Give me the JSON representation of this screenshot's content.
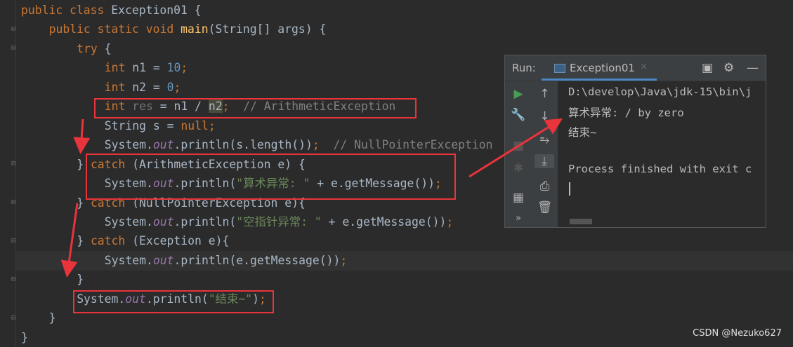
{
  "code_lines": [
    [
      [
        "public class ",
        "kw"
      ],
      [
        "Exception01 {",
        ""
      ]
    ],
    [
      [
        "public static void ",
        "kw"
      ],
      [
        "main",
        "fn"
      ],
      [
        "(String[] args) {",
        ""
      ]
    ],
    [
      [
        "try ",
        "kw"
      ],
      [
        "{",
        ""
      ]
    ],
    [
      [
        "int ",
        "kw"
      ],
      [
        "n1 = ",
        ""
      ],
      [
        "10",
        "num"
      ],
      [
        ";",
        "semi"
      ]
    ],
    [
      [
        "int ",
        "kw"
      ],
      [
        "n2 = ",
        ""
      ],
      [
        "0",
        "num"
      ],
      [
        ";",
        "semi"
      ]
    ],
    [
      [
        "int ",
        "kw"
      ],
      [
        "res",
        "unused"
      ],
      [
        " = n1 / ",
        ""
      ],
      [
        "n2",
        "hl"
      ],
      [
        ";",
        "semi"
      ],
      [
        "  // ArithmeticException",
        "cmt"
      ]
    ],
    [
      [
        "String s = ",
        ""
      ],
      [
        "null",
        "kw"
      ],
      [
        ";",
        "semi"
      ]
    ],
    [
      [
        "System.",
        ""
      ],
      [
        "out",
        "fld"
      ],
      [
        ".println(s.length())",
        ""
      ],
      [
        ";",
        "semi"
      ],
      [
        "  // NullPointerException",
        "cmt"
      ]
    ],
    [
      [
        "} ",
        ""
      ],
      [
        "catch ",
        "kw"
      ],
      [
        "(ArithmeticException e) {",
        ""
      ]
    ],
    [
      [
        "System.",
        ""
      ],
      [
        "out",
        "fld"
      ],
      [
        ".println(",
        ""
      ],
      [
        "\"算术异常: \"",
        "str"
      ],
      [
        " + e.getMessage())",
        ""
      ],
      [
        ";",
        "semi"
      ]
    ],
    [
      [
        "} ",
        ""
      ],
      [
        "catch ",
        "kw"
      ],
      [
        "(NullPointerException e){",
        ""
      ]
    ],
    [
      [
        "System.",
        ""
      ],
      [
        "out",
        "fld"
      ],
      [
        ".println(",
        ""
      ],
      [
        "\"空指针异常: \"",
        "str"
      ],
      [
        " + e.getMessage())",
        ""
      ],
      [
        ";",
        "semi"
      ]
    ],
    [
      [
        "} ",
        ""
      ],
      [
        "catch ",
        "kw"
      ],
      [
        "(Exception e){",
        ""
      ]
    ],
    [
      [
        "System.",
        ""
      ],
      [
        "out",
        "fld"
      ],
      [
        ".println(e.getMessage())",
        ""
      ],
      [
        ";",
        "semi"
      ]
    ],
    [
      [
        "}",
        ""
      ]
    ],
    [
      [
        "System.",
        ""
      ],
      [
        "out",
        "fld"
      ],
      [
        ".println(",
        ""
      ],
      [
        "\"结束~\"",
        "str"
      ],
      [
        ")",
        ""
      ],
      [
        ";",
        "semi"
      ]
    ],
    [
      [
        "}",
        ""
      ]
    ],
    [
      [
        "}",
        ""
      ]
    ]
  ],
  "code_indents": [
    0,
    1,
    2,
    3,
    3,
    3,
    3,
    3,
    2,
    3,
    2,
    3,
    2,
    3,
    2,
    2,
    1,
    0
  ],
  "run_panel": {
    "label": "Run:",
    "tab": "Exception01",
    "tab_close": "×",
    "console_lines": [
      "D:\\develop\\Java\\jdk-15\\bin\\j",
      "算术异常: / by zero",
      "结束~",
      "",
      "Process finished with exit c"
    ]
  },
  "watermark": "CSDN @Nezuko627",
  "colors": {
    "annotation": "#e8343a",
    "background": "#2b2b2b"
  }
}
